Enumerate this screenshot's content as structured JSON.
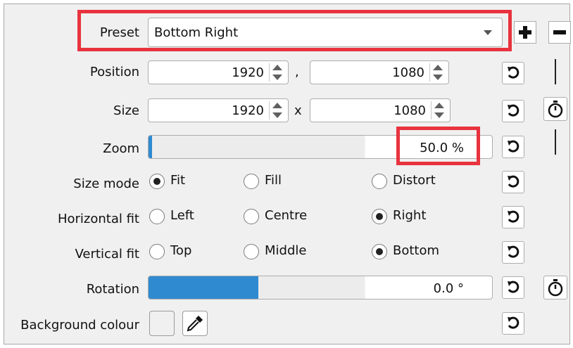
{
  "preset": {
    "label": "Preset",
    "value": "Bottom Right"
  },
  "position": {
    "label": "Position",
    "x": "1920",
    "separator": ",",
    "y": "1080"
  },
  "size": {
    "label": "Size",
    "w": "1920",
    "separator": "x",
    "h": "1080"
  },
  "zoom": {
    "label": "Zoom",
    "value": "50.0 %",
    "fill_fraction": 0.01
  },
  "size_mode": {
    "label": "Size mode",
    "options": [
      "Fit",
      "Fill",
      "Distort"
    ],
    "selected": "Fit"
  },
  "horizontal_fit": {
    "label": "Horizontal fit",
    "options": [
      "Left",
      "Centre",
      "Right"
    ],
    "selected": "Right"
  },
  "vertical_fit": {
    "label": "Vertical fit",
    "options": [
      "Top",
      "Middle",
      "Bottom"
    ],
    "selected": "Bottom"
  },
  "rotation": {
    "label": "Rotation",
    "value": "0.0 °",
    "fill_fraction": 0.32
  },
  "background": {
    "label": "Background colour"
  },
  "colors": {
    "highlight": "#e8333f",
    "slider_fill": "#2f8ad0"
  },
  "icons": [
    "plus-icon",
    "minus-icon",
    "reset-icon",
    "stopwatch-icon",
    "eyedropper-icon",
    "dropdown-arrow-icon"
  ]
}
